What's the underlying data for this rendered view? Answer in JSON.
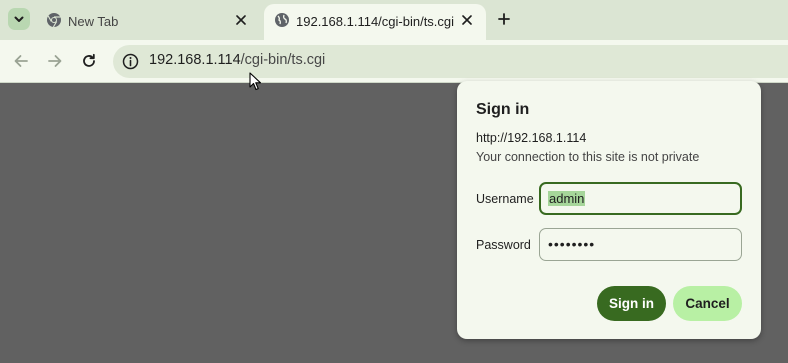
{
  "tabs": [
    {
      "title": "New Tab",
      "active": false,
      "icon": "chrome-icon"
    },
    {
      "title": "192.168.1.114/cgi-bin/ts.cgi",
      "active": true,
      "icon": "globe-icon"
    }
  ],
  "address_bar": {
    "host": "192.168.1.114",
    "path": "/cgi-bin/ts.cgi",
    "security_icon": "info-icon"
  },
  "dialog": {
    "title": "Sign in",
    "host": "http://192.168.1.114",
    "warning": "Your connection to this site is not private",
    "username_label": "Username",
    "username_value": "admin",
    "password_label": "Password",
    "password_value": "••••••••",
    "signin_label": "Sign in",
    "cancel_label": "Cancel"
  },
  "colors": {
    "accent": "#386a20",
    "button_secondary": "#b8f0a4",
    "page_background": "#616161"
  }
}
